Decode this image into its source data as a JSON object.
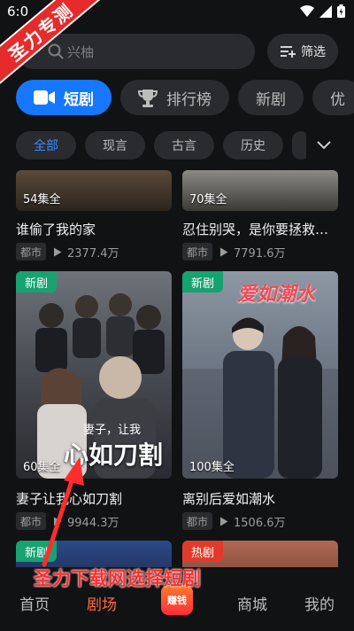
{
  "status": {
    "time": "6:0"
  },
  "watermark": {
    "text": "圣力专测"
  },
  "search": {
    "placeholder": "兴柚",
    "filter_label": "筛选"
  },
  "tabs": [
    {
      "label": "短剧",
      "active": true
    },
    {
      "label": "排行榜",
      "active": false
    },
    {
      "label": "新剧",
      "active": false
    },
    {
      "label": "优",
      "active": false
    }
  ],
  "chips": [
    {
      "label": "全部",
      "active": true
    },
    {
      "label": "现言",
      "active": false
    },
    {
      "label": "古言",
      "active": false
    },
    {
      "label": "历史",
      "active": false
    }
  ],
  "dramas": [
    {
      "episodes": "54集全",
      "title": "谁偷了我的家",
      "genre": "都市",
      "plays": "2377.4万"
    },
    {
      "episodes": "70集全",
      "title": "忍住别哭，是你要拯救苍...",
      "genre": "都市",
      "plays": "7791.6万"
    },
    {
      "badge": "新剧",
      "episodes": "60集全",
      "title": "妻子让我心如刀割",
      "poster_text": "心如刀割",
      "poster_subtext": "妻子，让我",
      "genre": "都市",
      "plays": "9944.3万"
    },
    {
      "badge": "新剧",
      "episodes": "100集全",
      "title": "离别后爱如潮水",
      "poster_text": "爱如潮水",
      "genre": "都市",
      "plays": "1506.6万"
    },
    {
      "badge": "新剧"
    },
    {
      "badge": "热剧"
    }
  ],
  "caption": {
    "text": "圣力下载网选择短剧"
  },
  "nav": {
    "home": "首页",
    "theater": "剧场",
    "earn": "赚钱",
    "mall": "商城",
    "mine": "我的"
  },
  "colors": {
    "accent": "#1677ff",
    "nav_active": "#ff6a3d",
    "badge_new": "#17a271",
    "badge_hot": "#e23a2a"
  }
}
